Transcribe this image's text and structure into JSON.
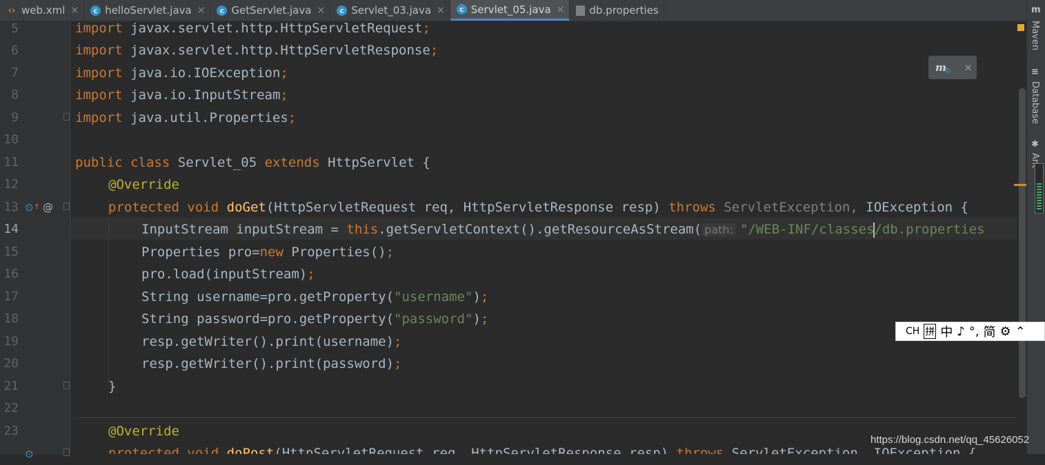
{
  "tabs": [
    {
      "label": "web.xml",
      "icon": "xml-file-icon",
      "active": false
    },
    {
      "label": "helloServlet.java",
      "icon": "java-class-icon",
      "active": false
    },
    {
      "label": "GetServlet.java",
      "icon": "java-class-icon",
      "active": false
    },
    {
      "label": "Servlet_03.java",
      "icon": "java-class-icon",
      "active": false
    },
    {
      "label": "Servlet_05.java",
      "icon": "java-class-icon",
      "active": true
    },
    {
      "label": "db.properties",
      "icon": "properties-file-icon",
      "active": false
    }
  ],
  "tab_close_glyph": "×",
  "line_numbers": [
    "5",
    "6",
    "7",
    "8",
    "9",
    "10",
    "11",
    "12",
    "13",
    "14",
    "15",
    "16",
    "17",
    "18",
    "19",
    "20",
    "21",
    "22",
    "23"
  ],
  "current_line": "14",
  "code": {
    "l5": {
      "kw": "import",
      "text": " javax.servlet.http.HttpServletRequest",
      "semi": ";"
    },
    "l6": {
      "kw": "import",
      "text": " javax.servlet.http.HttpServletResponse",
      "semi": ";"
    },
    "l7": {
      "kw": "import",
      "text": " java.io.IOException",
      "semi": ";"
    },
    "l8": {
      "kw": "import",
      "text": " java.io.InputStream",
      "semi": ";"
    },
    "l9": {
      "kw": "import",
      "text": " java.util.Properties",
      "semi": ";"
    },
    "l11": {
      "kw1": "public",
      "kw2": "class",
      "name": "Servlet_05",
      "kw3": "extends",
      "base": "HttpServlet",
      "brace": "{"
    },
    "l12": {
      "annotation": "@Override"
    },
    "l13": {
      "kw1": "protected",
      "kw2": "void",
      "method": "doGet",
      "params": "(HttpServletRequest req, HttpServletResponse resp)",
      "kw3": "throws",
      "ex1": "ServletException",
      "comma": ",",
      "ex2": " IOException {"
    },
    "l14": {
      "pre": "InputStream inputStream = ",
      "kw": "this",
      "call": ".getServletContext().getResourceAsStream(",
      "hint": "path:",
      "str1": "\"/WEB-INF/classes",
      "str2": "/db.properties"
    },
    "l15": {
      "pre": "Properties pro=",
      "kw": "new",
      "post": " Properties()",
      "semi": ";"
    },
    "l16": {
      "text": "pro.load(inputStream)",
      "semi": ";"
    },
    "l17": {
      "pre": "String username=pro.getProperty(",
      "str": "\"username\"",
      "post": ")",
      "semi": ";"
    },
    "l18": {
      "pre": "String password=pro.getProperty(",
      "str": "\"password\"",
      "post": ")",
      "semi": ";"
    },
    "l19": {
      "text": "resp.getWriter().print(username)",
      "semi": ";"
    },
    "l20": {
      "text": "resp.getWriter().print(password)",
      "semi": ";"
    },
    "l21": {
      "text": "}"
    },
    "l23": {
      "annotation": "@Override"
    },
    "l24": {
      "kw1": "protected",
      "kw2": "void",
      "method": "doPost",
      "params": "(HttpServletRequest req, HttpServletResponse resp)",
      "kw3": "throws",
      "ex": " ServletException, IOException {"
    }
  },
  "sidebar": [
    {
      "label": "Maven",
      "icon": "maven-icon",
      "glyph": "m"
    },
    {
      "label": "Database",
      "icon": "database-icon",
      "glyph": "≡"
    },
    {
      "label": "Ant",
      "icon": "ant-icon",
      "glyph": "✱"
    }
  ],
  "maven_popup": {
    "glyph": "m",
    "close": "×"
  },
  "ime_toolbar": {
    "items": [
      "CH",
      "拼",
      "中",
      "♪",
      "°,",
      "简",
      "⚙",
      "⌃"
    ]
  },
  "watermark": "https://blog.csdn.net/qq_45626052",
  "colors": {
    "keyword": "#cc7832",
    "string": "#6a8759",
    "annotation": "#bbb529",
    "method": "#ffc66d",
    "text": "#a9b7c6",
    "background": "#2b2b2b",
    "accent": "#4a88c7"
  }
}
